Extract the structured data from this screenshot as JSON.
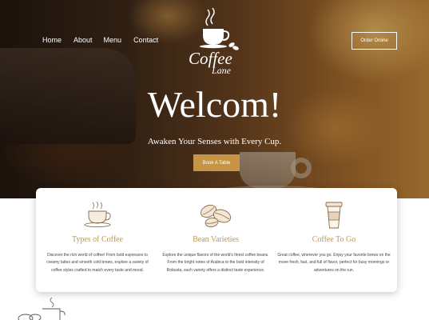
{
  "nav": {
    "items": [
      {
        "label": "Home"
      },
      {
        "label": "About"
      },
      {
        "label": "Menu"
      },
      {
        "label": "Contact"
      }
    ]
  },
  "logo": {
    "line1": "Coffee",
    "line2": "Lane"
  },
  "header": {
    "order_label": "Order Online"
  },
  "hero": {
    "title": "Welcom!",
    "subtitle": "Awaken Your Senses with Every Cup.",
    "cta_label": "Book A Table"
  },
  "features": [
    {
      "icon": "coffee-cup-icon",
      "title": "Types of Coffee",
      "text": "Discover the rich world of coffee! From bold espressos to creamy lattes and smooth cold brews, explore a variety of coffee styles crafted to match every taste and mood."
    },
    {
      "icon": "coffee-beans-icon",
      "title": "Bean Varieties",
      "text": "Explore the unique flavors of the world's finest coffee beans. From the bright notes of Arabica to the bold intensity of Robusta, each variety offers a distinct taste experience."
    },
    {
      "icon": "takeaway-cup-icon",
      "title": "Coffee To Go",
      "text": "Great coffee, wherever you go. Enjoy your favorite brews on the move fresh, fast, and full of flavor, perfect for busy mornings or adventures on the run."
    }
  ],
  "colors": {
    "accent": "#c69444"
  }
}
